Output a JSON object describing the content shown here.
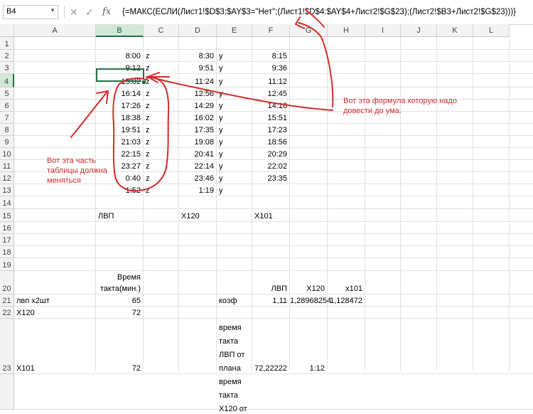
{
  "formula_bar": {
    "name_box": "B4",
    "cancel_icon": "✕",
    "enter_icon": "✓",
    "fx_icon": "fx",
    "formula": "{=МАКС(ЕСЛИ(Лист1!$D$3:$AY$3=\"Нет\";(Лист1!$D$4:$AY$4+Лист2!$G$23);(Лист2!$B3+Лист2!$G$23)))}"
  },
  "columns": [
    "A",
    "B",
    "C",
    "D",
    "E",
    "F",
    "G",
    "H",
    "I",
    "J",
    "K",
    "L"
  ],
  "rows": [
    "1",
    "2",
    "3",
    "4",
    "5",
    "6",
    "7",
    "8",
    "9",
    "10",
    "11",
    "12",
    "13",
    "14",
    "15",
    "16",
    "17",
    "18",
    "19",
    "20",
    "21",
    "22",
    "23",
    ""
  ],
  "time_rows": [
    {
      "b": "8:00",
      "c": "z",
      "d": "8:30",
      "e": "y",
      "f": "8:15"
    },
    {
      "b": "9:12",
      "c": "z",
      "d": "9:51",
      "e": "y",
      "f": "9:36"
    },
    {
      "b": "15:02",
      "c": "z",
      "d": "11:24",
      "e": "y",
      "f": "11:12"
    },
    {
      "b": "16:14",
      "c": "z",
      "d": "12:56",
      "e": "y",
      "f": "12:45"
    },
    {
      "b": "17:26",
      "c": "z",
      "d": "14:29",
      "e": "y",
      "f": "14:18"
    },
    {
      "b": "18:38",
      "c": "z",
      "d": "16:02",
      "e": "y",
      "f": "15:51"
    },
    {
      "b": "19:51",
      "c": "z",
      "d": "17:35",
      "e": "y",
      "f": "17:23"
    },
    {
      "b": "21:03",
      "c": "z",
      "d": "19:08",
      "e": "y",
      "f": "18:56"
    },
    {
      "b": "22:15",
      "c": "z",
      "d": "20:41",
      "e": "y",
      "f": "20:29"
    },
    {
      "b": "23:27",
      "c": "z",
      "d": "22:14",
      "e": "y",
      "f": "22:02"
    },
    {
      "b": "0:40",
      "c": "z",
      "d": "23:46",
      "e": "y",
      "f": "23:35"
    },
    {
      "b": "1:52",
      "c": "z",
      "d": "1:19",
      "e": "y",
      "f": ""
    }
  ],
  "row15": {
    "b": "ЛВП",
    "d": "X120",
    "f": "X101"
  },
  "row20": {
    "b1": "Время",
    "b2": "такта(мин.)",
    "f": "ЛВП",
    "g": "X120",
    "h": "x101"
  },
  "row21": {
    "a": "лвп x2шт",
    "b": "65",
    "e": "коэф",
    "f": "1,11",
    "g": "1,28968254",
    "h": "1,128472"
  },
  "row22": {
    "a": "X120",
    "b": "72"
  },
  "row23": {
    "a": "X101",
    "b": "72",
    "e_lines": [
      "время",
      "такта",
      "ЛВП от",
      "плана"
    ],
    "f": "72,22222",
    "g": "1:12"
  },
  "row24": {
    "e_lines": [
      "время",
      "такта",
      "X120 от"
    ]
  },
  "notes": {
    "left": [
      "Вот эта часть",
      "таблицы должна",
      "меняться"
    ],
    "right": [
      "Вот эта формула которую надо",
      "довести до ума."
    ]
  },
  "colors": {
    "annotation": "#d12b2b",
    "selection": "#217346",
    "header_bg": "#f3f3f3"
  }
}
